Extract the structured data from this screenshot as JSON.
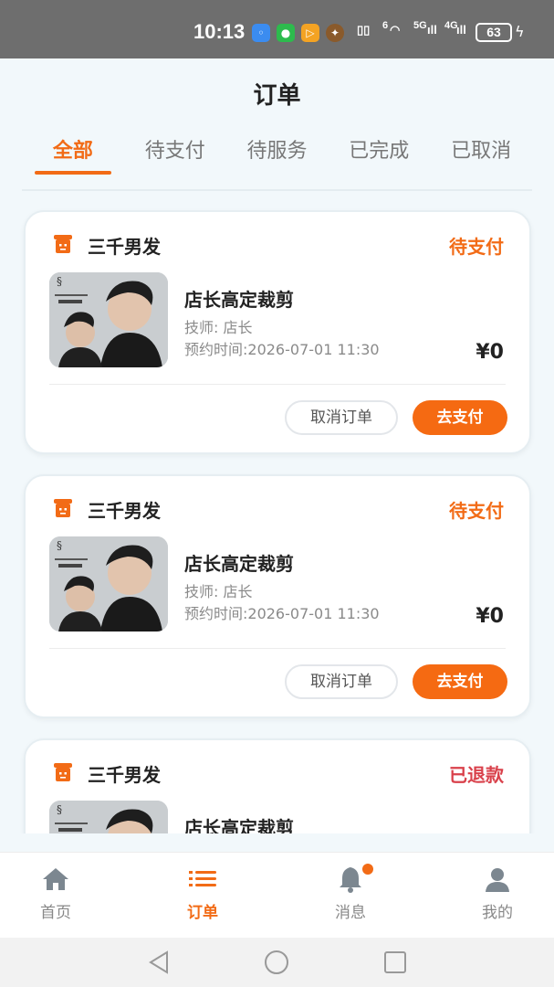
{
  "status_bar": {
    "time": "10:13",
    "network_1": "6",
    "network_2": "5G",
    "network_3": "4G",
    "battery": "63"
  },
  "header": {
    "title": "订单"
  },
  "tabs": [
    {
      "label": "全部",
      "active": true
    },
    {
      "label": "待支付",
      "active": false
    },
    {
      "label": "待服务",
      "active": false
    },
    {
      "label": "已完成",
      "active": false
    },
    {
      "label": "已取消",
      "active": false
    }
  ],
  "orders": [
    {
      "shop": "三千男发",
      "status": "待支付",
      "service": "店长高定裁剪",
      "technician": "技师:  店长",
      "appointment": "预约时间:2026-07-01 11:30",
      "price": "¥0",
      "cancel_label": "取消订单",
      "pay_label": "去支付"
    },
    {
      "shop": "三千男发",
      "status": "待支付",
      "service": "店长高定裁剪",
      "technician": "技师:  店长",
      "appointment": "预约时间:2026-07-01 11:30",
      "price": "¥0",
      "cancel_label": "取消订单",
      "pay_label": "去支付"
    },
    {
      "shop": "三千男发",
      "status": "已退款",
      "service": "店长高定裁剪"
    }
  ],
  "bottom_nav": [
    {
      "label": "首页",
      "icon": "home-icon",
      "active": false
    },
    {
      "label": "订单",
      "icon": "list-icon",
      "active": true
    },
    {
      "label": "消息",
      "icon": "bell-icon",
      "active": false,
      "badge": true
    },
    {
      "label": "我的",
      "icon": "user-icon",
      "active": false
    }
  ],
  "colors": {
    "accent": "#f26b16",
    "refund": "#d9414b",
    "background": "#f2f8fb"
  }
}
